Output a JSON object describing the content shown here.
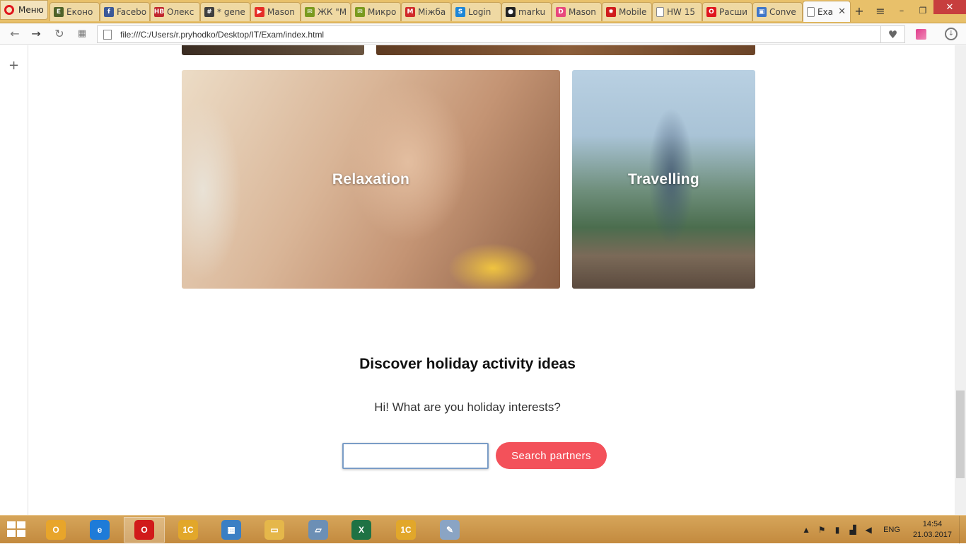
{
  "browser": {
    "menu_label": "Меню",
    "tabs": [
      {
        "label": "Еконо",
        "favicon": "E",
        "color": "#4f6228"
      },
      {
        "label": "Facebo",
        "favicon": "f",
        "color": "#3b5998"
      },
      {
        "label": "Олекс",
        "favicon": "НВ",
        "color": "#c0262d"
      },
      {
        "label": "* gene",
        "favicon": "#",
        "color": "#3e3e3e"
      },
      {
        "label": "Mason",
        "favicon": "▶",
        "color": "#e52d27"
      },
      {
        "label": "ЖК \"М",
        "favicon": "✉",
        "color": "#7a9a1e"
      },
      {
        "label": "Микро",
        "favicon": "✉",
        "color": "#7a9a1e"
      },
      {
        "label": "Міжба",
        "favicon": "M",
        "color": "#d02a2a"
      },
      {
        "label": "Login",
        "favicon": "S",
        "color": "#1d86d7"
      },
      {
        "label": "marku",
        "favicon": "●",
        "color": "#222222"
      },
      {
        "label": "Mason",
        "favicon": "D",
        "color": "#e8477c"
      },
      {
        "label": "Mobile",
        "favicon": "✹",
        "color": "#d01c1c"
      },
      {
        "label": "HW 15",
        "favicon": "",
        "color": "#ffffff"
      },
      {
        "label": "Расши",
        "favicon": "O",
        "color": "#e0161e"
      },
      {
        "label": "Conve",
        "favicon": "▣",
        "color": "#3f76c8"
      },
      {
        "label": "Exa",
        "favicon": "",
        "color": "#ffffff",
        "active": true
      }
    ],
    "url": "file:///C:/Users/r.pryhodko/Desktop/IT/Exam/index.html"
  },
  "page": {
    "cards": {
      "relax_label": "Relaxation",
      "travel_label": "Travelling"
    },
    "section_title": "Discover holiday activity ideas",
    "section_subtitle": "Hi! What are you holiday interests?",
    "search": {
      "value": "",
      "placeholder": "",
      "button_label": "Search partners"
    },
    "accent_color": "#f3515a"
  },
  "taskbar": {
    "apps": [
      {
        "name": "outlook-app",
        "glyph": "O",
        "color": "#e8a52a"
      },
      {
        "name": "ie-app",
        "glyph": "e",
        "color": "#1e7bd8"
      },
      {
        "name": "opera-app",
        "glyph": "O",
        "color": "#d11a1a",
        "active": true
      },
      {
        "name": "1c-app",
        "glyph": "1C",
        "color": "#e2a72a"
      },
      {
        "name": "remote-app",
        "glyph": "▦",
        "color": "#3b7fc4"
      },
      {
        "name": "explorer-app",
        "glyph": "▭",
        "color": "#e5b74a"
      },
      {
        "name": "notepad-app",
        "glyph": "▱",
        "color": "#6c8fb5"
      },
      {
        "name": "excel-app",
        "glyph": "X",
        "color": "#1f7244"
      },
      {
        "name": "1c-app-2",
        "glyph": "1C",
        "color": "#e2a72a"
      },
      {
        "name": "paint-app",
        "glyph": "✎",
        "color": "#8aa4c4"
      }
    ],
    "language": "ENG",
    "time": "14:54",
    "date": "21.03.2017"
  }
}
